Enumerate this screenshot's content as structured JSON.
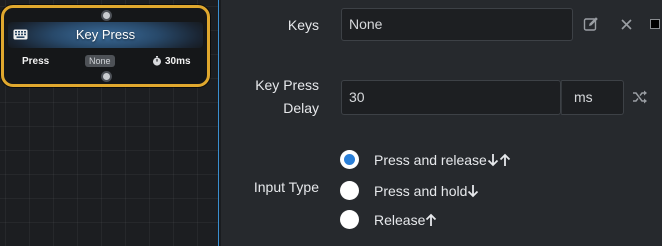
{
  "node": {
    "title": "Key Press",
    "action": "Press",
    "key": "None",
    "delay": "30ms"
  },
  "keys": {
    "label": "Keys",
    "value": "None"
  },
  "key_press_delay": {
    "label_line1": "Key Press",
    "label_line2": "Delay",
    "value": "30",
    "unit": "ms"
  },
  "input_type": {
    "label": "Input Type",
    "options": [
      {
        "label": "Press and release",
        "selected": true
      },
      {
        "label": "Press and hold",
        "selected": false
      },
      {
        "label": "Release",
        "selected": false
      }
    ]
  },
  "colors": {
    "accent": "#2a7fd8",
    "node_border": "#e0a82e"
  },
  "icons": [
    "keyboard-icon",
    "stopwatch-icon",
    "edit-icon",
    "close-icon",
    "random-icon",
    "arrow-down-icon",
    "arrow-up-icon"
  ]
}
